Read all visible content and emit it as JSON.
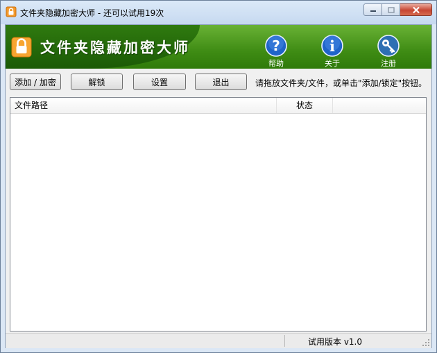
{
  "window": {
    "title": "文件夹隐藏加密大师 - 还可以试用19次"
  },
  "banner": {
    "app_name": "文件夹隐藏加密大师",
    "help_label": "帮助",
    "about_label": "关于",
    "register_label": "注册"
  },
  "toolbar": {
    "add_encrypt_label": "添加 / 加密",
    "unlock_label": "解锁",
    "settings_label": "设置",
    "exit_label": "退出",
    "hint": "请拖放文件夹/文件，或单击\"添加/锁定\"按钮。"
  },
  "list": {
    "columns": [
      "文件路径",
      "状态"
    ],
    "rows": []
  },
  "statusbar": {
    "version_text": "试用版本 v1.0"
  },
  "colors": {
    "banner_green": "#3f8c14",
    "banner_dark_green": "#1b5a06",
    "icon_blue": "#1f64c8"
  }
}
